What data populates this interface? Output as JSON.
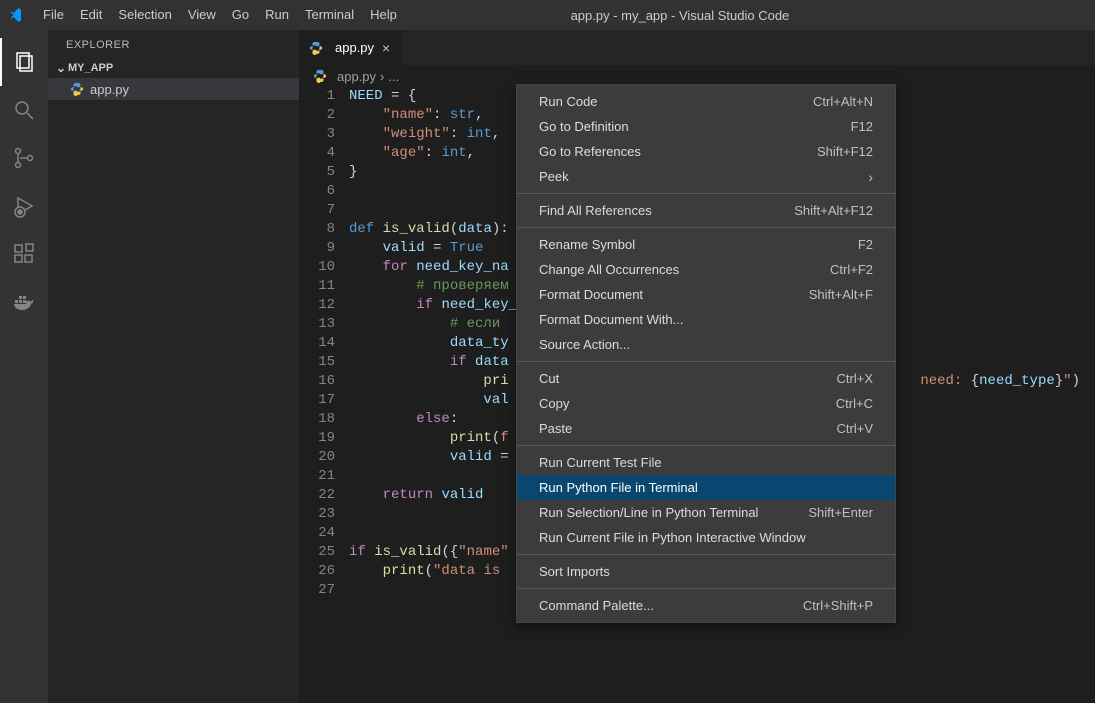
{
  "title": "app.py - my_app - Visual Studio Code",
  "menu": {
    "items": [
      "File",
      "Edit",
      "Selection",
      "View",
      "Go",
      "Run",
      "Terminal",
      "Help"
    ]
  },
  "explorer": {
    "title": "EXPLORER",
    "root": "MY_APP",
    "file": "app.py"
  },
  "tab": {
    "label": "app.py"
  },
  "breadcrumbs": {
    "file": "app.py",
    "sep": "›",
    "rest": "..."
  },
  "code": {
    "lines": [
      {
        "n": 1,
        "html": "<span class='var'>NEED</span> <span class='op'>=</span> {"
      },
      {
        "n": 2,
        "html": "    <span class='str'>\"name\"</span>: <span class='kw'>str</span>,"
      },
      {
        "n": 3,
        "html": "    <span class='str'>\"weight\"</span>: <span class='kw'>int</span>,"
      },
      {
        "n": 4,
        "html": "    <span class='str'>\"age\"</span>: <span class='kw'>int</span>,"
      },
      {
        "n": 5,
        "html": "}"
      },
      {
        "n": 6,
        "html": ""
      },
      {
        "n": 7,
        "html": ""
      },
      {
        "n": 8,
        "html": "<span class='kw'>def</span> <span class='fn'>is_valid</span>(<span class='var'>data</span>):"
      },
      {
        "n": 9,
        "html": "    <span class='var'>valid</span> <span class='op'>=</span> <span class='const'>True</span>"
      },
      {
        "n": 10,
        "html": "    <span class='kw2'>for</span> <span class='var'>need_key_na</span>"
      },
      {
        "n": 11,
        "html": "        <span class='cmt'># проверяем</span>"
      },
      {
        "n": 12,
        "html": "        <span class='kw2'>if</span> <span class='var'>need_key_</span>"
      },
      {
        "n": 13,
        "html": "            <span class='cmt'># если </span>"
      },
      {
        "n": 14,
        "html": "            <span class='var'>data_ty</span>"
      },
      {
        "n": 15,
        "html": "            <span class='kw2'>if</span> <span class='var'>data</span>"
      },
      {
        "n": 16,
        "html": "                <span class='fn'>pri</span>                                                 <span class='str'>need: </span>{<span class='var'>need_type</span>}<span class='str'>\"</span>)"
      },
      {
        "n": 17,
        "html": "                <span class='var'>val</span>"
      },
      {
        "n": 18,
        "html": "        <span class='kw2'>else</span>:"
      },
      {
        "n": 19,
        "html": "            <span class='fn'>print</span>(<span class='str'>f</span>"
      },
      {
        "n": 20,
        "html": "            <span class='var'>valid</span> <span class='op'>=</span>"
      },
      {
        "n": 21,
        "html": ""
      },
      {
        "n": 22,
        "html": "    <span class='kw2'>return</span> <span class='var'>valid</span>"
      },
      {
        "n": 23,
        "html": ""
      },
      {
        "n": 24,
        "html": ""
      },
      {
        "n": 25,
        "html": "<span class='kw2'>if</span> <span class='fn'>is_valid</span>({<span class='str'>\"name\"</span>"
      },
      {
        "n": 26,
        "html": "    <span class='fn'>print</span>(<span class='str'>\"data is </span>"
      },
      {
        "n": 27,
        "html": ""
      }
    ]
  },
  "context_menu": {
    "groups": [
      [
        {
          "label": "Run Code",
          "key": "Ctrl+Alt+N"
        },
        {
          "label": "Go to Definition",
          "key": "F12"
        },
        {
          "label": "Go to References",
          "key": "Shift+F12"
        },
        {
          "label": "Peek",
          "arrow": true
        }
      ],
      [
        {
          "label": "Find All References",
          "key": "Shift+Alt+F12"
        }
      ],
      [
        {
          "label": "Rename Symbol",
          "key": "F2"
        },
        {
          "label": "Change All Occurrences",
          "key": "Ctrl+F2"
        },
        {
          "label": "Format Document",
          "key": "Shift+Alt+F"
        },
        {
          "label": "Format Document With..."
        },
        {
          "label": "Source Action..."
        }
      ],
      [
        {
          "label": "Cut",
          "key": "Ctrl+X"
        },
        {
          "label": "Copy",
          "key": "Ctrl+C"
        },
        {
          "label": "Paste",
          "key": "Ctrl+V"
        }
      ],
      [
        {
          "label": "Run Current Test File"
        },
        {
          "label": "Run Python File in Terminal",
          "highlight": true
        },
        {
          "label": "Run Selection/Line in Python Terminal",
          "key": "Shift+Enter"
        },
        {
          "label": "Run Current File in Python Interactive Window"
        }
      ],
      [
        {
          "label": "Sort Imports"
        }
      ],
      [
        {
          "label": "Command Palette...",
          "key": "Ctrl+Shift+P"
        }
      ]
    ]
  }
}
